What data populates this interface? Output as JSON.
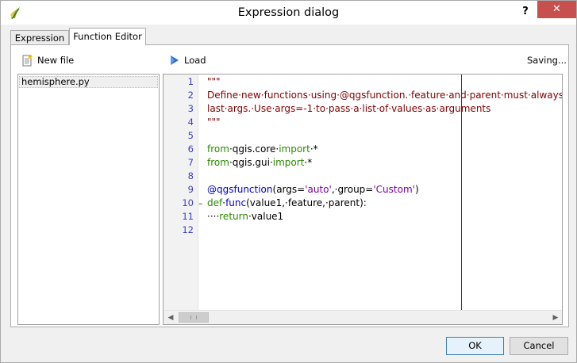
{
  "window": {
    "title": "Expression dialog",
    "help_label": "?",
    "close_label": "✕"
  },
  "tabs": [
    {
      "label": "Expression",
      "active": false
    },
    {
      "label": "Function Editor",
      "active": true
    }
  ],
  "toolbar": {
    "new_file_label": "New file",
    "load_label": "Load",
    "status": "Saving..."
  },
  "files": [
    {
      "name": "hemisphere.py",
      "selected": true
    }
  ],
  "editor": {
    "line_numbers": [
      "1",
      "2",
      "3",
      "4",
      "5",
      "6",
      "7",
      "8",
      "9",
      "10",
      "11",
      "12"
    ],
    "fold_marker_line": 10,
    "fold_marker": "–",
    "lines": [
      [
        {
          "t": "\"\"\"",
          "c": "str"
        }
      ],
      [
        {
          "t": "Define·new·functions·using·@qgsfunction.·feature·and·parent·must·always·be·",
          "c": "str"
        }
      ],
      [
        {
          "t": "last·args.·Use·args=-1·to·pass·a·list·of·values·as·arguments",
          "c": "str"
        }
      ],
      [
        {
          "t": "\"\"\"",
          "c": "str"
        }
      ],
      [],
      [
        {
          "t": "from",
          "c": "kw"
        },
        {
          "t": "·qgis.core·",
          "c": "txt"
        },
        {
          "t": "import",
          "c": "kw"
        },
        {
          "t": "·*",
          "c": "txt"
        }
      ],
      [
        {
          "t": "from",
          "c": "kw"
        },
        {
          "t": "·qgis.gui·",
          "c": "txt"
        },
        {
          "t": "import",
          "c": "kw"
        },
        {
          "t": "·*",
          "c": "txt"
        }
      ],
      [],
      [
        {
          "t": "@qgsfunction",
          "c": "def"
        },
        {
          "t": "(args=",
          "c": "txt"
        },
        {
          "t": "'auto'",
          "c": "sval"
        },
        {
          "t": ",·group=",
          "c": "txt"
        },
        {
          "t": "'Custom'",
          "c": "sval"
        },
        {
          "t": ")",
          "c": "txt"
        }
      ],
      [
        {
          "t": "def",
          "c": "kw"
        },
        {
          "t": "·",
          "c": "txt"
        },
        {
          "t": "func",
          "c": "def"
        },
        {
          "t": "(value1,·feature,·parent):",
          "c": "txt"
        }
      ],
      [
        {
          "t": "····",
          "c": "txt"
        },
        {
          "t": "return",
          "c": "kw"
        },
        {
          "t": "·value1",
          "c": "txt"
        }
      ],
      []
    ]
  },
  "buttons": {
    "ok_label": "OK",
    "cancel_label": "Cancel"
  },
  "colors": {
    "edge_line": "#c40000",
    "close_button": "#c7504f"
  }
}
